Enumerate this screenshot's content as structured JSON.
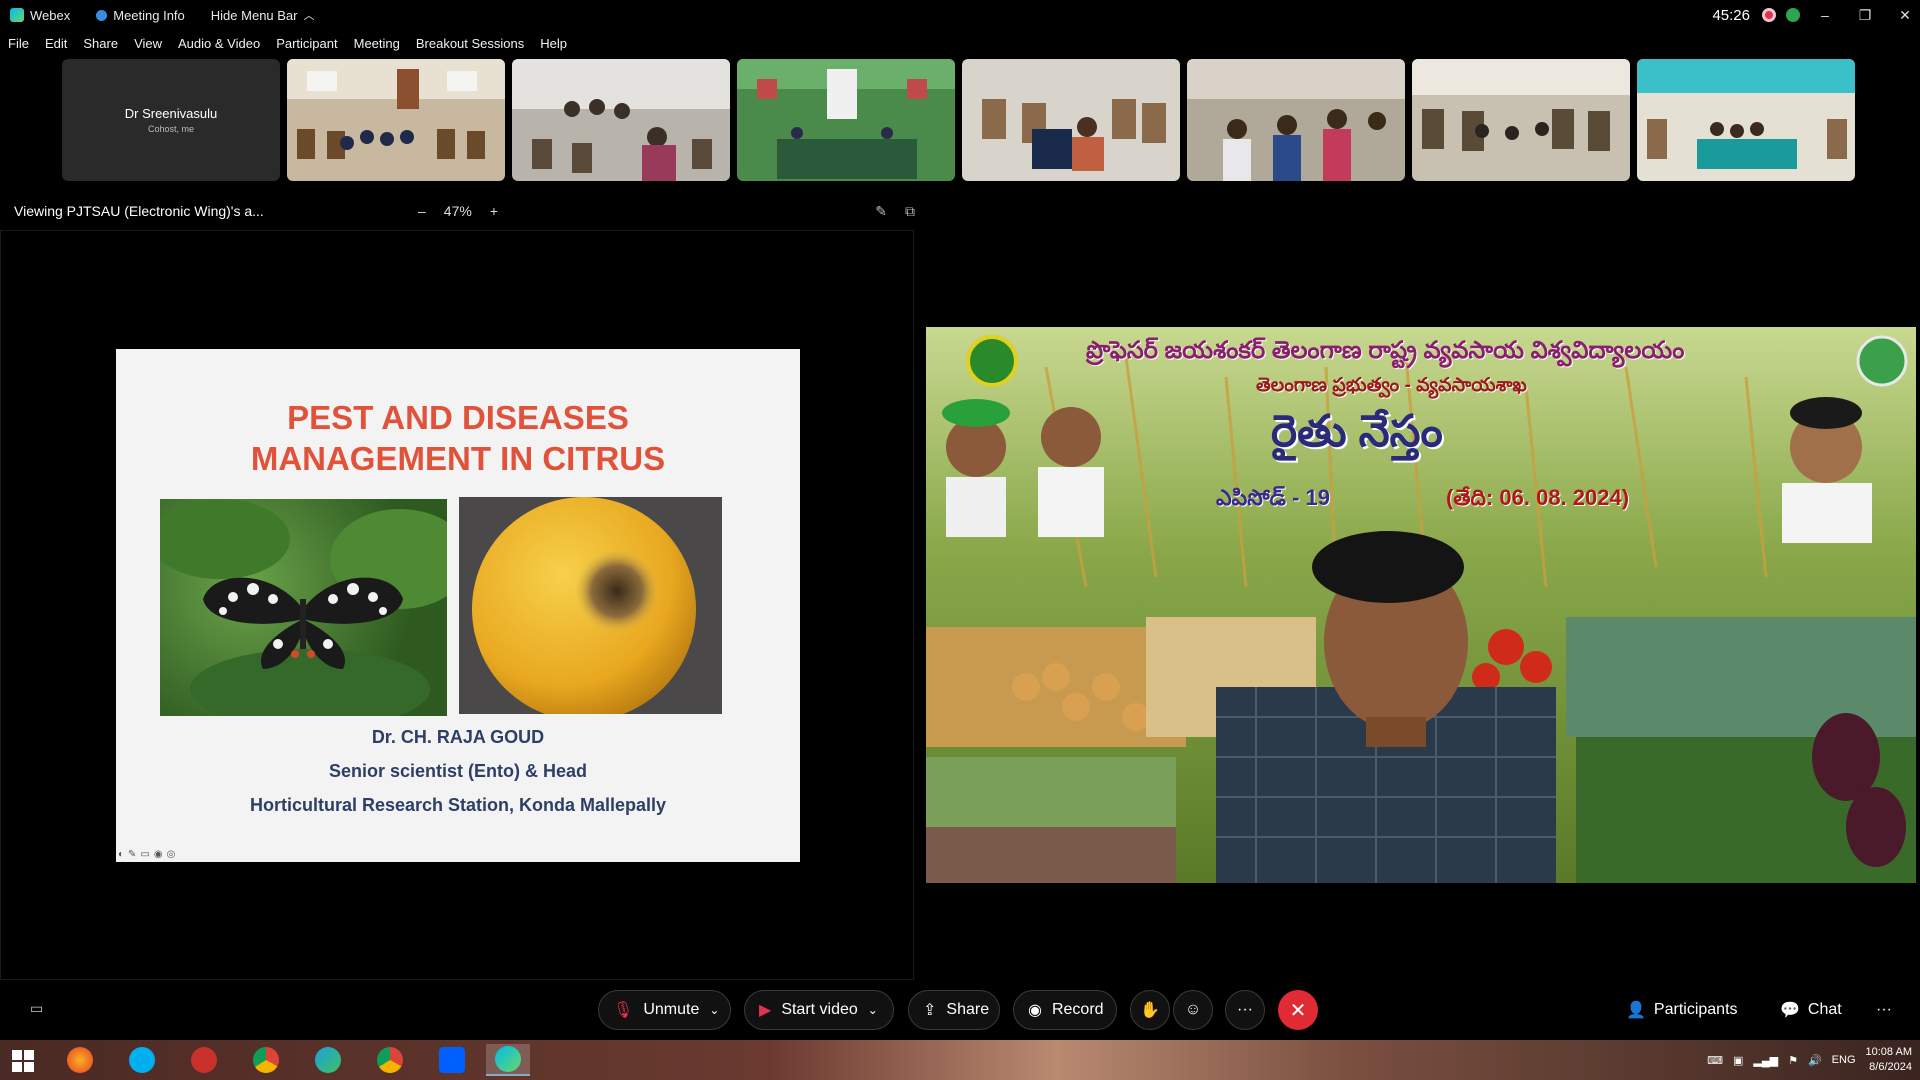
{
  "titlebar": {
    "app_name": "Webex",
    "meeting_info": "Meeting Info",
    "hide_menu": "Hide Menu Bar",
    "timer": "45:26",
    "minimize": "–",
    "restore": "❐",
    "close": "✕"
  },
  "menu": [
    "File",
    "Edit",
    "Share",
    "View",
    "Audio & Video",
    "Participant",
    "Meeting",
    "Breakout Sessions",
    "Help"
  ],
  "self_tile": {
    "name": "Dr Sreenivasulu",
    "role": "Cohost, me"
  },
  "viewing": {
    "label": "Viewing PJTSAU (Electronic Wing)'s a...",
    "zoom_out": "–",
    "zoom": "47%",
    "zoom_in": "+"
  },
  "slide": {
    "title_line1": "PEST AND DISEASES",
    "title_line2": "MANAGEMENT IN  CITRUS",
    "author": "Dr. CH. RAJA GOUD",
    "position": "Senior scientist (Ento) & Head",
    "station": "Horticultural Research Station, Konda Mallepally"
  },
  "banner": {
    "university": "ప్రొఫెసర్ జయశంకర్ తెలంగాణ రాష్ట్ర వ్యవసాయ విశ్వవిద్యాలయం",
    "department": "తెలంగాణ ప్రభుత్వం - వ్యవసాయశాఖ",
    "program": "రైతు నేస్తం",
    "episode": "ఎపిసోడ్ - 19",
    "date": "(తేది: 06. 08. 2024)"
  },
  "controls": {
    "unmute": "Unmute",
    "start_video": "Start video",
    "share": "Share",
    "record": "Record",
    "more": "···",
    "participants": "Participants",
    "chat": "Chat",
    "overflow": "···"
  },
  "taskbar": {
    "lang": "ENG",
    "time": "10:08 AM",
    "date": "8/6/2024"
  }
}
